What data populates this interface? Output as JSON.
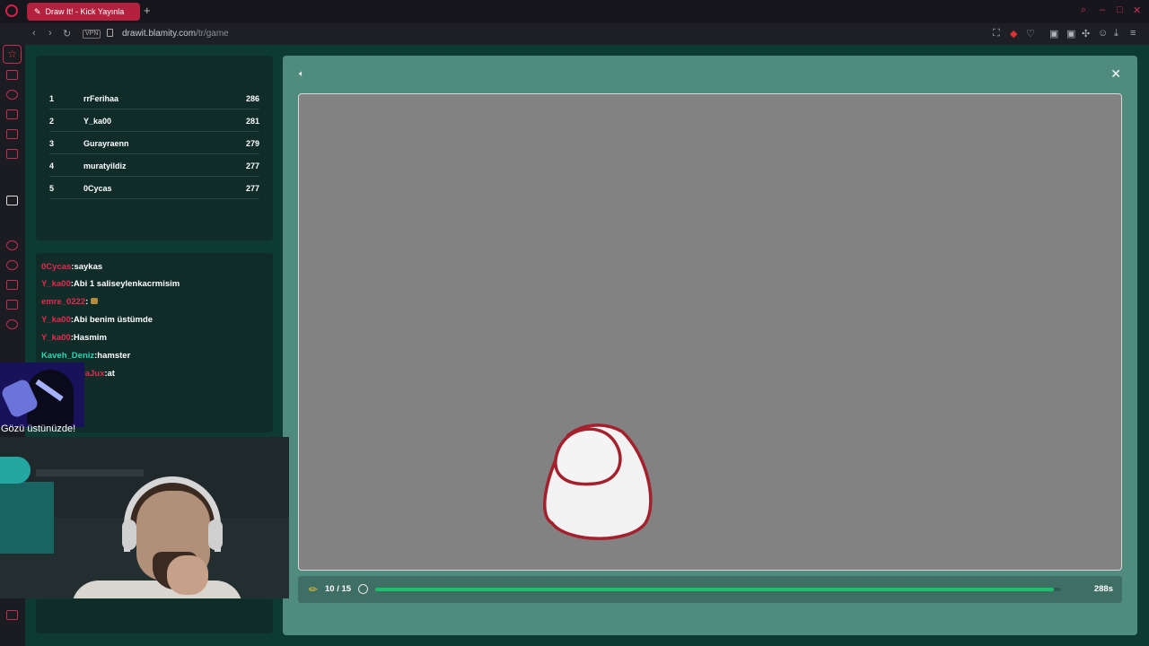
{
  "browser": {
    "tab_title": "Draw It! - Kick Yayınla",
    "new_tab_symbol": "+",
    "vpn_label": "VPN",
    "url_host": "drawit.blamity.com",
    "url_path": "/tr/game"
  },
  "leaderboard": [
    {
      "rank": "1",
      "name": "rrFerihaa",
      "score": "286"
    },
    {
      "rank": "2",
      "name": "Y_ka00",
      "score": "281"
    },
    {
      "rank": "3",
      "name": "Gurayraenn",
      "score": "279"
    },
    {
      "rank": "4",
      "name": "muratyildiz",
      "score": "277"
    },
    {
      "rank": "5",
      "name": "0Cycas",
      "score": "277"
    }
  ],
  "chat": [
    {
      "user": "0Cycas",
      "message": ":saykas",
      "user_color": "#e8284f"
    },
    {
      "user": "Y_ka00",
      "message": ":Abi 1 saliseylenkacrmisim",
      "user_color": "#e8284f"
    },
    {
      "user": "emre_0222",
      "message": ":",
      "user_color": "#e8284f"
    },
    {
      "user": "Y_ka00",
      "message": ":Abi benim üstümde",
      "user_color": "#e8284f"
    },
    {
      "user": "Y_ka00",
      "message": ":Hasmim",
      "user_color": "#e8284f"
    },
    {
      "user": "Kaveh_Deniz",
      "message": ":hamster",
      "user_color": "#26d6b3"
    },
    {
      "user": "raJux",
      "message": ":at",
      "user_color": "#e8284f"
    }
  ],
  "overlay": {
    "caption": "Gözü üstünüzde!"
  },
  "game": {
    "round_label": "10 / 15",
    "seconds_label": "288s",
    "progress_fraction": 0.99,
    "canvas_color": "#828282",
    "accent_progress": "#19c26a",
    "stroke_color": "#a3202c"
  }
}
